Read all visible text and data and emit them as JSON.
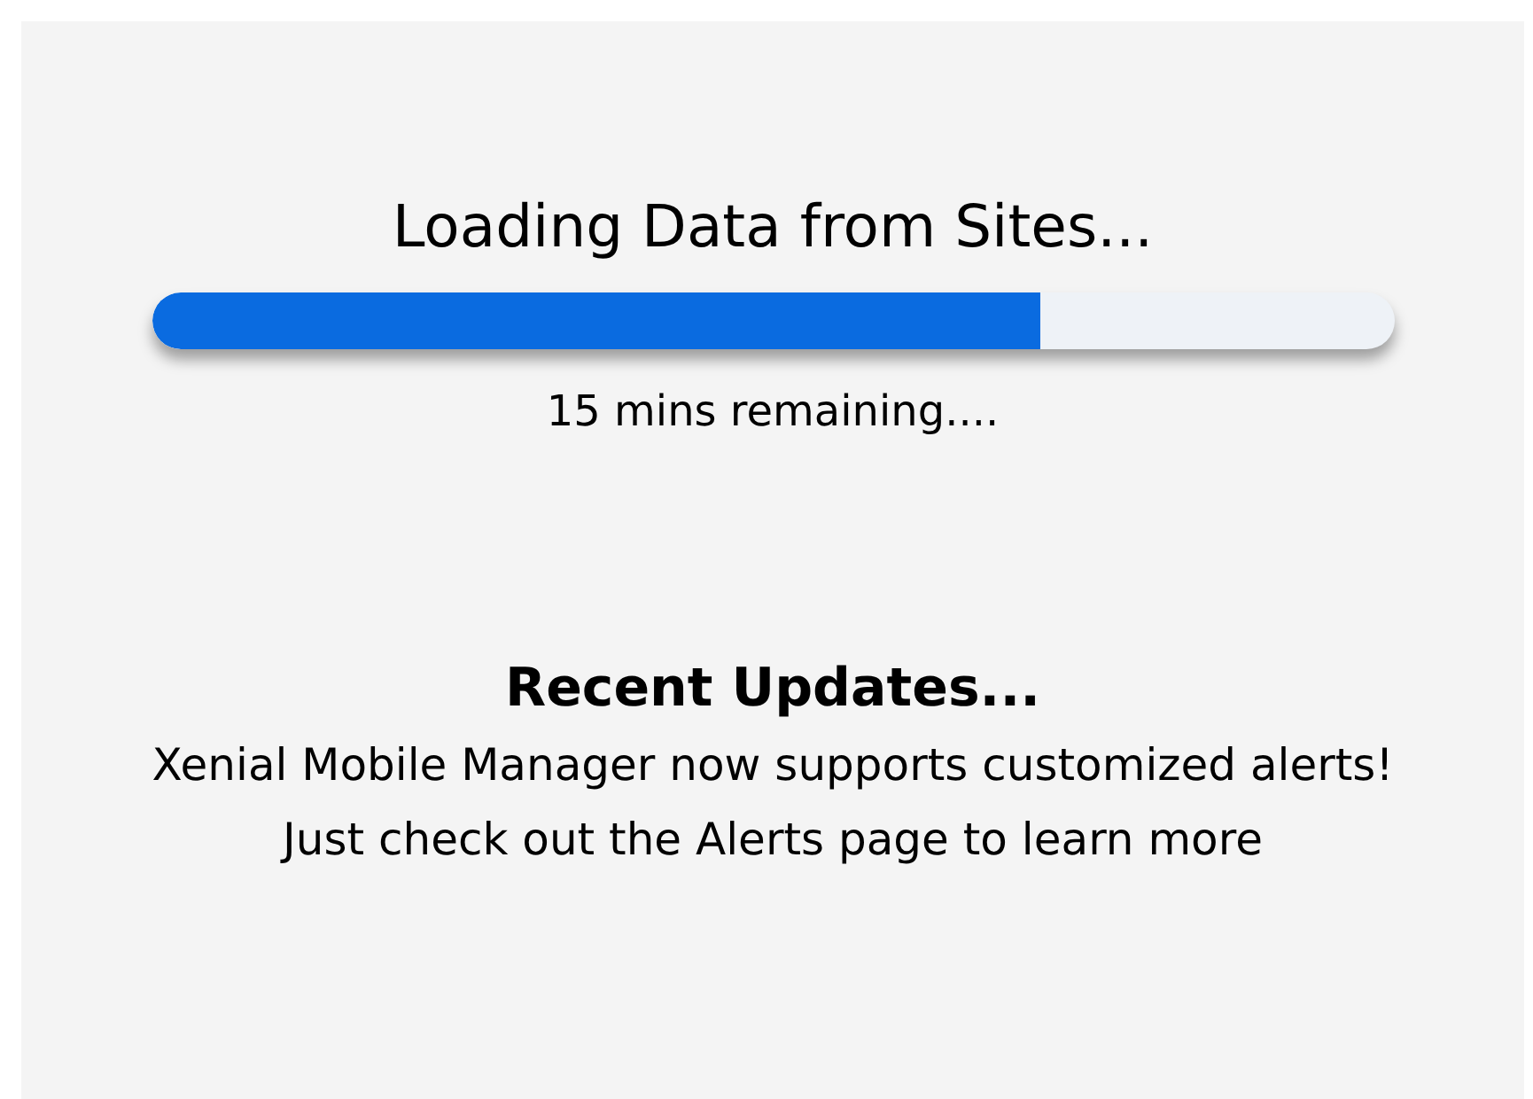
{
  "loading": {
    "title": "Loading Data from Sites...",
    "progress": {
      "level": 0.716
    },
    "remaining": "15 mins remaining...."
  },
  "updates": {
    "heading": "Recent Updates...",
    "message": "Xenial Mobile Manager now supports customized alerts! Just check out the Alerts page to learn more"
  }
}
